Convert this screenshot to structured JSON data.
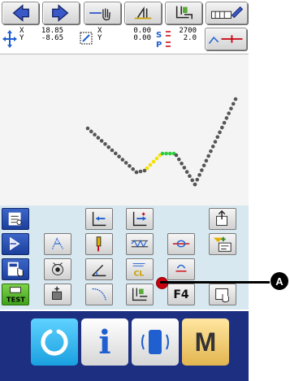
{
  "readouts": {
    "xy_values": [
      "18.85",
      "-8.65"
    ],
    "xy2_values": [
      "0.00",
      "0.00"
    ],
    "sp_values": [
      "2700",
      "2.0"
    ]
  },
  "toolbar_labels": {
    "f4": "F4"
  },
  "callout": {
    "badge": "A"
  },
  "bottom_bar": {
    "m_label": "M",
    "info_label": "i"
  },
  "colors": {
    "bottom_bg": "#1c2f80",
    "grid_bg": "#d8e8f0",
    "stitch_dark": "#555555",
    "stitch_highlight_yellow": "#f5e000",
    "stitch_highlight_green": "#2ecc40",
    "callout_red": "#c8000f"
  }
}
